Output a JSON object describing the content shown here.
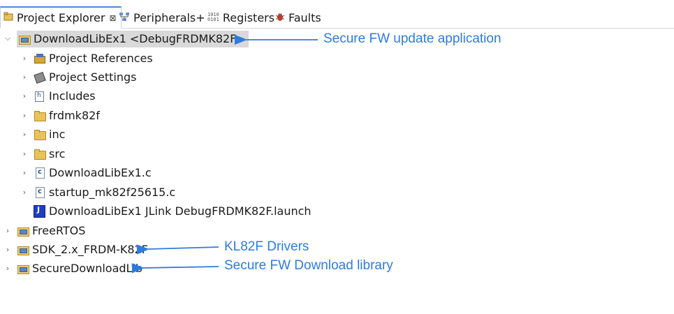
{
  "tabs": [
    {
      "label": "Project Explorer",
      "active": true,
      "icon": "project-explorer-icon",
      "close": "⊠"
    },
    {
      "label": "Peripherals+",
      "active": false,
      "icon": "peripherals-icon"
    },
    {
      "label": "Registers",
      "active": false,
      "icon": "registers-icon"
    },
    {
      "label": "Faults",
      "active": false,
      "icon": "faults-icon"
    }
  ],
  "tree": {
    "root": {
      "label": "DownloadLibEx1 <DebugFRDMK82F>",
      "expanded": true,
      "selected": true
    },
    "children": [
      {
        "label": "Project References",
        "icon": "project-references-icon"
      },
      {
        "label": "Project Settings",
        "icon": "project-settings-icon"
      },
      {
        "label": "Includes",
        "icon": "includes-icon"
      },
      {
        "label": "frdmk82f",
        "icon": "folder-icon"
      },
      {
        "label": "inc",
        "icon": "folder-icon"
      },
      {
        "label": "src",
        "icon": "folder-icon"
      },
      {
        "label": "DownloadLibEx1.c",
        "icon": "c-file-icon"
      },
      {
        "label": "startup_mk82f25615.c",
        "icon": "c-file-icon"
      },
      {
        "label": "DownloadLibEx1 JLink DebugFRDMK82F.launch",
        "icon": "launch-file-icon"
      }
    ],
    "siblings": [
      {
        "label": "FreeRTOS",
        "icon": "project-icon"
      },
      {
        "label": "SDK_2.x_FRDM-K82F",
        "icon": "project-icon"
      },
      {
        "label": "SecureDownloadLib",
        "icon": "project-icon"
      }
    ]
  },
  "annotations": [
    {
      "text": "Secure FW update application"
    },
    {
      "text": "KL82F Drivers"
    },
    {
      "text": "Secure FW Download library"
    }
  ],
  "colors": {
    "annotation": "#2d7be0",
    "selection": "#d9d9d9",
    "accent": "#4b8ad6"
  }
}
